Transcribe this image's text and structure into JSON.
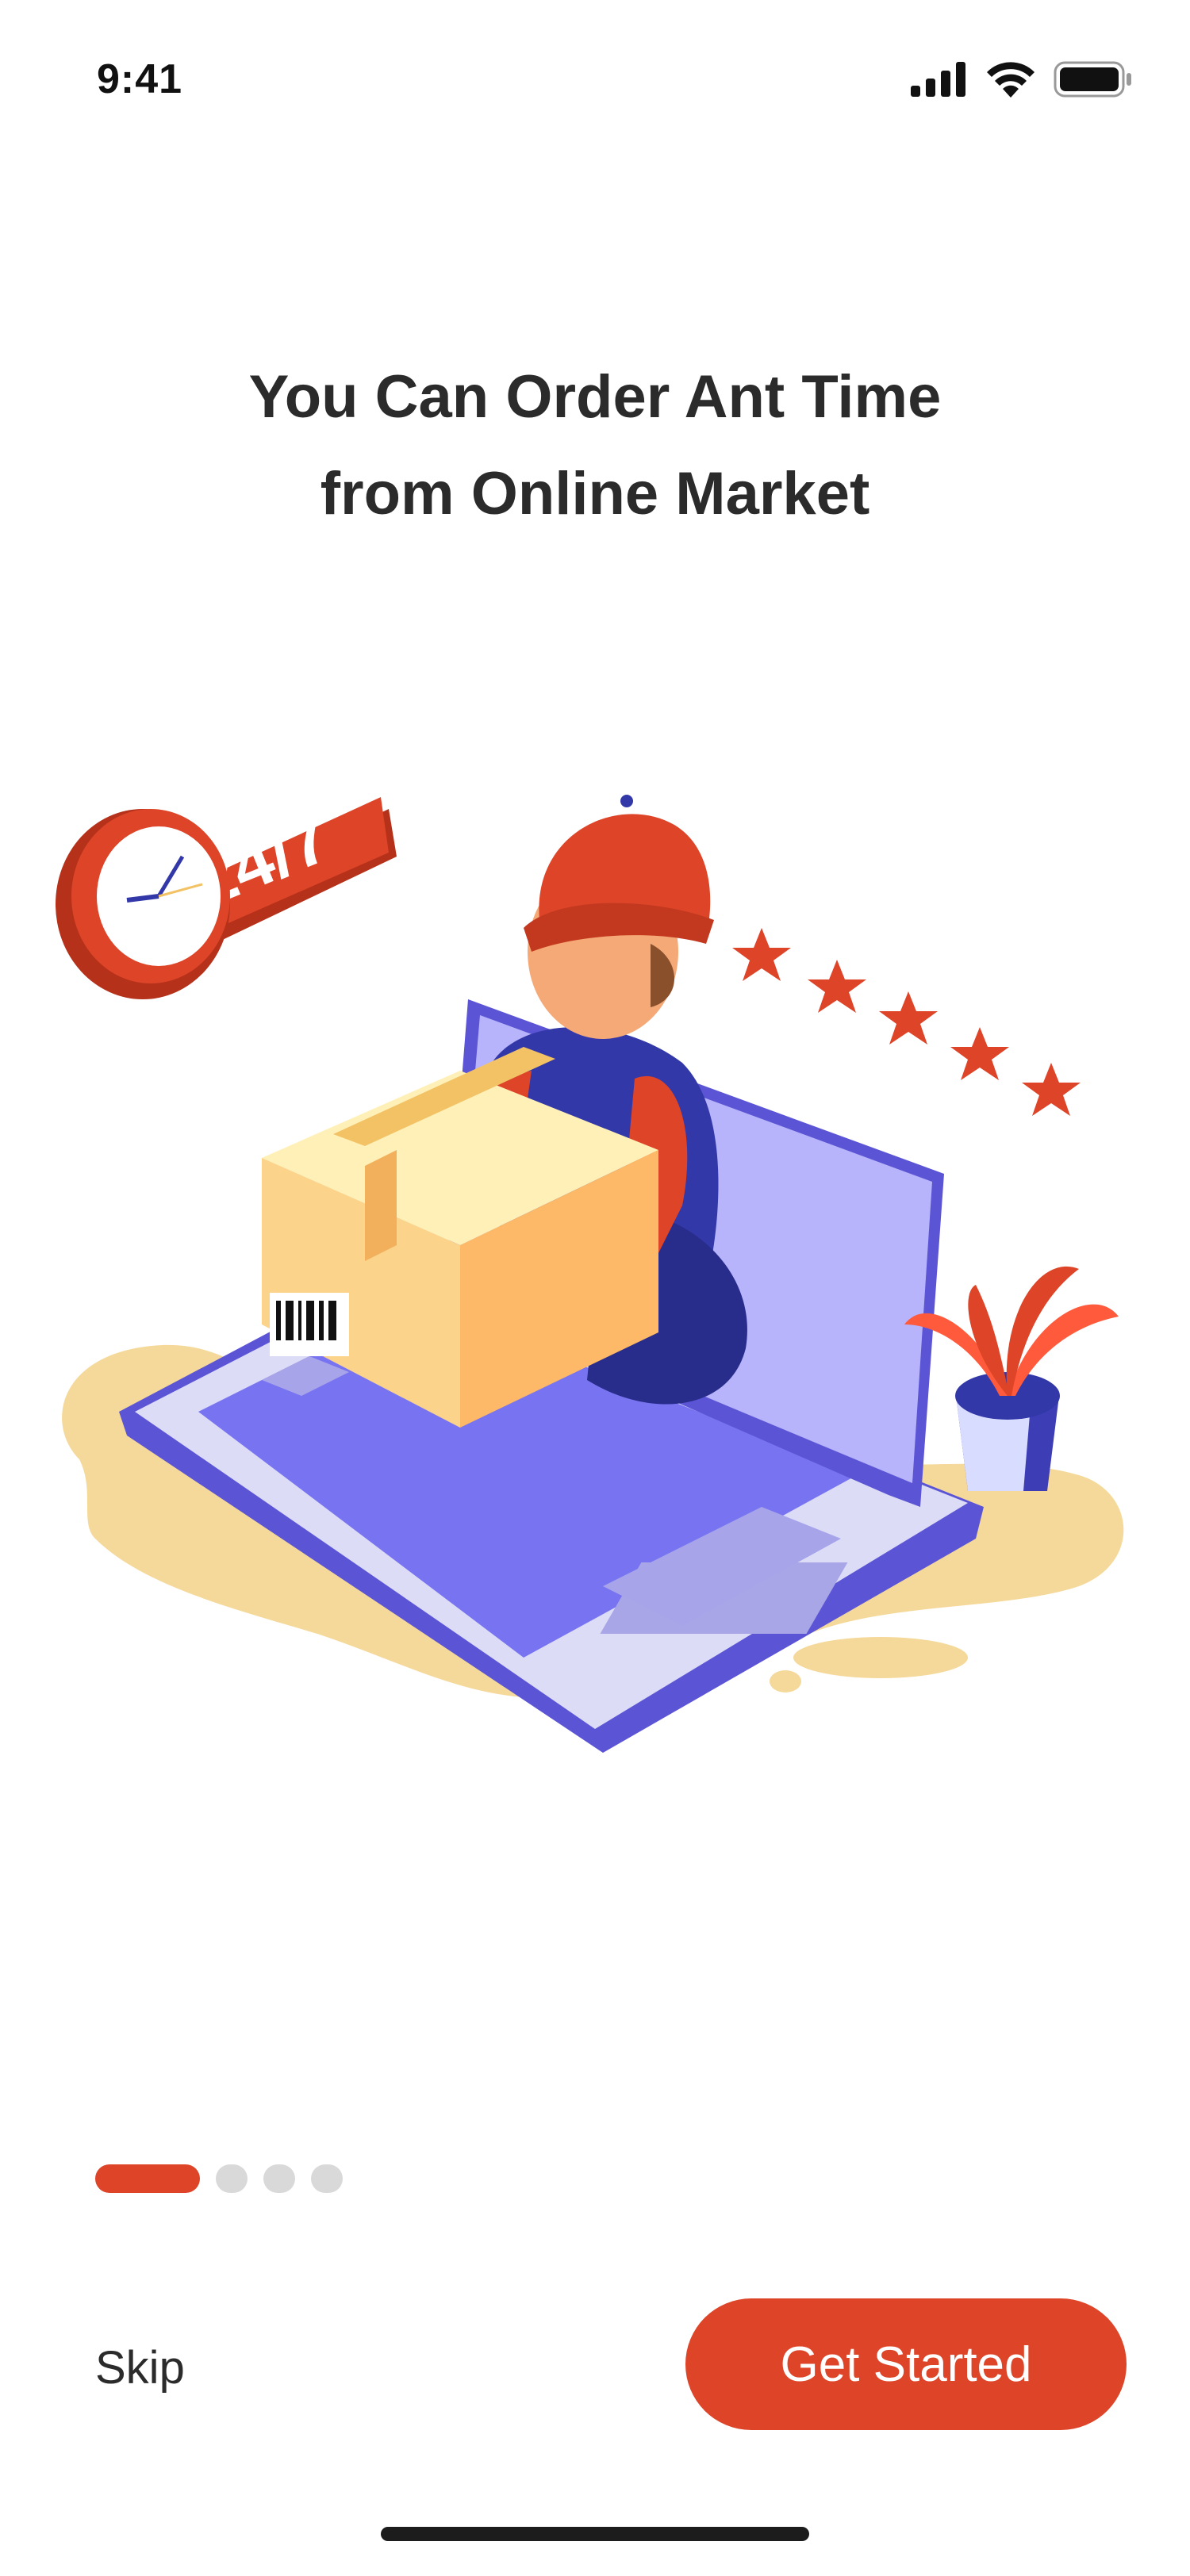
{
  "status_bar": {
    "time": "9:41",
    "icons": [
      "cellular-signal-icon",
      "wifi-icon",
      "battery-icon"
    ]
  },
  "onboarding": {
    "headline_line1": "You Can Order Ant Time",
    "headline_line2": "from Online Market",
    "illustration": {
      "name": "courier-delivering-box-from-laptop",
      "badge_text": "24/7",
      "rating_stars": 5
    },
    "pager": {
      "total_pages": 4,
      "current_page": 1
    }
  },
  "actions": {
    "skip_label": "Skip",
    "get_started_label": "Get Started"
  },
  "colors": {
    "accent": "#dd4428",
    "text": "#2b2b2b",
    "inactive_dot": "#d9d9d9",
    "laptop_purple": "#7672f0",
    "sand": "#f5d99a"
  }
}
